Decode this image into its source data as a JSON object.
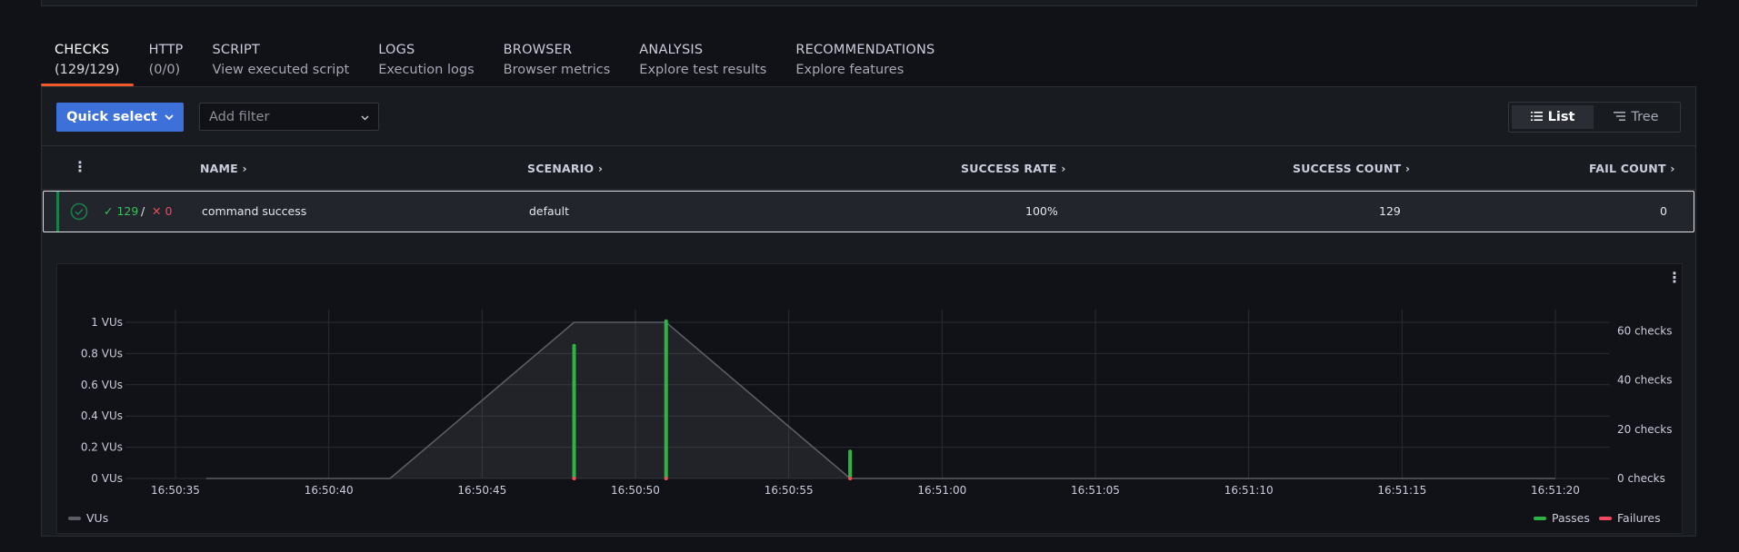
{
  "tabs": [
    {
      "title": "CHECKS",
      "subtitle": "(129/129)",
      "active": true
    },
    {
      "title": "HTTP",
      "subtitle": "(0/0)"
    },
    {
      "title": "SCRIPT",
      "subtitle": "View executed script"
    },
    {
      "title": "LOGS",
      "subtitle": "Execution logs"
    },
    {
      "title": "BROWSER",
      "subtitle": "Browser metrics"
    },
    {
      "title": "ANALYSIS",
      "subtitle": "Explore test results"
    },
    {
      "title": "RECOMMENDATIONS",
      "subtitle": "Explore features"
    }
  ],
  "toolbar": {
    "quick_select": "Quick select",
    "filter_placeholder": "Add filter",
    "view_list": "List",
    "view_tree": "Tree",
    "active_view": "List"
  },
  "table": {
    "columns": [
      "NAME",
      "SCENARIO",
      "SUCCESS RATE",
      "SUCCESS COUNT",
      "FAIL COUNT"
    ],
    "rows": [
      {
        "passes": "129",
        "separator": "/",
        "fails": "0",
        "name": "command success",
        "scenario": "default",
        "success_rate": "100%",
        "success_count": "129",
        "fail_count": "0"
      }
    ]
  },
  "colors": {
    "accent": "#3d71d9",
    "tab_indicator": "#f05a28",
    "pass": "#2fb344",
    "fail": "#f2495c",
    "vus_line": "#5a5d66"
  },
  "chart_data": {
    "type": "line",
    "x_ticks": [
      "16:50:35",
      "16:50:40",
      "16:50:45",
      "16:50:50",
      "16:50:55",
      "16:51:00",
      "16:51:05",
      "16:51:10",
      "16:51:15",
      "16:51:20"
    ],
    "left_axis": {
      "ticks": [
        "0 VUs",
        "0.2 VUs",
        "0.4 VUs",
        "0.6 VUs",
        "0.8 VUs",
        "1 VUs"
      ],
      "range": [
        0,
        1
      ]
    },
    "right_axis": {
      "ticks": [
        "0 checks",
        "20 checks",
        "40 checks",
        "60 checks"
      ],
      "range": [
        0,
        65
      ]
    },
    "vus": {
      "name": "VUs",
      "x": [
        "16:50:36",
        "16:50:42",
        "16:50:48",
        "16:50:51",
        "16:50:57",
        "16:51:20"
      ],
      "y": [
        0,
        0,
        1,
        1,
        0,
        0
      ]
    },
    "checks": {
      "x": [
        "16:50:48",
        "16:50:51",
        "16:50:57"
      ],
      "passes": {
        "name": "Passes",
        "values": [
          54,
          64,
          11
        ]
      },
      "failures": {
        "name": "Failures",
        "values": [
          0,
          0,
          0
        ]
      }
    },
    "legend": {
      "left": [
        "VUs"
      ],
      "right": [
        "Passes",
        "Failures"
      ]
    }
  }
}
